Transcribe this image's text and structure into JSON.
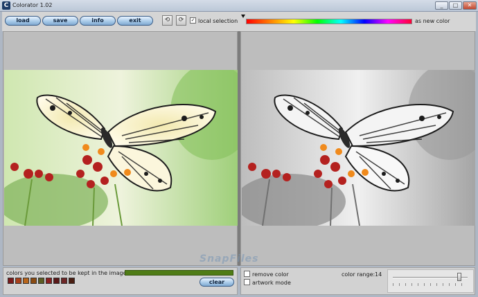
{
  "window": {
    "title": "Colorator 1.02",
    "icon_letter": "C",
    "minimize": "_",
    "maximize": "□",
    "close": "✕"
  },
  "toolbar": {
    "load": "load",
    "save": "save",
    "info": "info",
    "exit": "exit",
    "undo_icon": "⟲",
    "redo_icon": "⟳",
    "local_selection_checked": "✓",
    "local_selection": "local selection",
    "as_new_color": "as new color"
  },
  "kept": {
    "label": "colors you selected to be kept in the image",
    "swatches": [
      "#7a1b1b",
      "#a8401a",
      "#b8651b",
      "#8a4b12",
      "#5c5c23",
      "#8b2020",
      "#5a1818",
      "#6e2727",
      "#4a1e12"
    ],
    "kept_bar_color": "#4f7c16",
    "clear": "clear"
  },
  "options": {
    "remove_color": "remove color",
    "artwork_mode": "artwork mode",
    "color_range_label": "color range:",
    "color_range_value": "14"
  },
  "colors": {
    "accent": "#385b86",
    "panel": "#bdbdbd"
  },
  "watermark": "SnapFiles"
}
